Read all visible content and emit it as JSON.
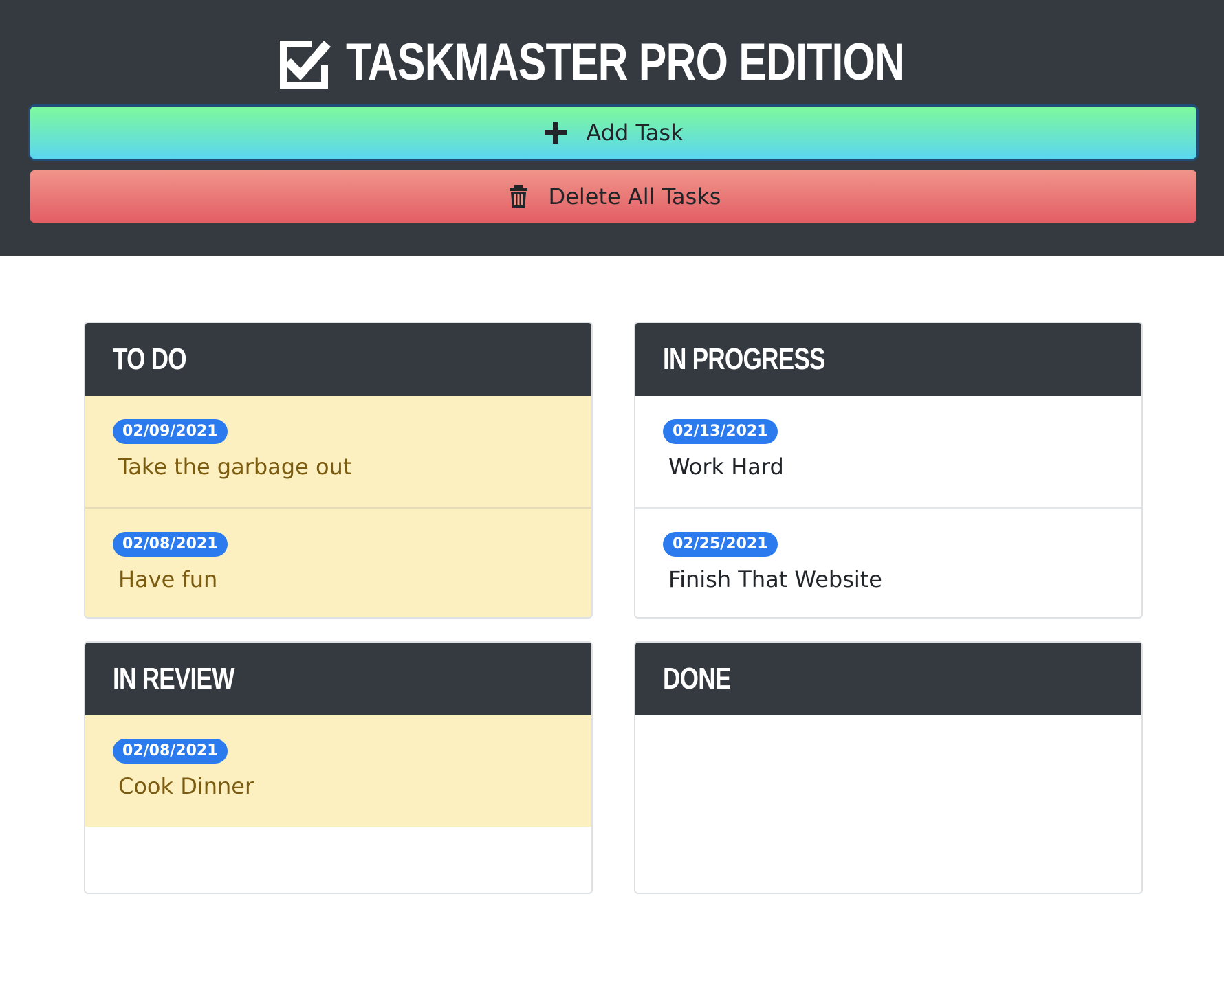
{
  "header": {
    "title": "Taskmaster Pro Edition",
    "title_icon": "checkbox-checked-icon",
    "add_button": {
      "label": "Add Task",
      "icon": "plus-icon"
    },
    "delete_button": {
      "label": "Delete All Tasks",
      "icon": "trash-icon"
    }
  },
  "colors": {
    "header_bg": "#343a40",
    "add_gradient": [
      "#7ef99b",
      "#5bd6f0"
    ],
    "delete_gradient": [
      "#f0948a",
      "#e35e65"
    ],
    "badge": "#2b7bee",
    "due_soon_bg": "#fcefc0"
  },
  "lists": {
    "todo": {
      "title": "To Do",
      "tasks": [
        {
          "date": "02/09/2021",
          "text": "Take the garbage out",
          "highlight": true
        },
        {
          "date": "02/08/2021",
          "text": "Have fun",
          "highlight": true
        }
      ]
    },
    "in_progress": {
      "title": "In Progress",
      "tasks": [
        {
          "date": "02/13/2021",
          "text": "Work Hard",
          "highlight": false
        },
        {
          "date": "02/25/2021",
          "text": "Finish That Website",
          "highlight": false
        }
      ]
    },
    "in_review": {
      "title": "In Review",
      "tasks": [
        {
          "date": "02/08/2021",
          "text": "Cook Dinner",
          "highlight": true
        }
      ]
    },
    "done": {
      "title": "Done",
      "tasks": []
    }
  }
}
